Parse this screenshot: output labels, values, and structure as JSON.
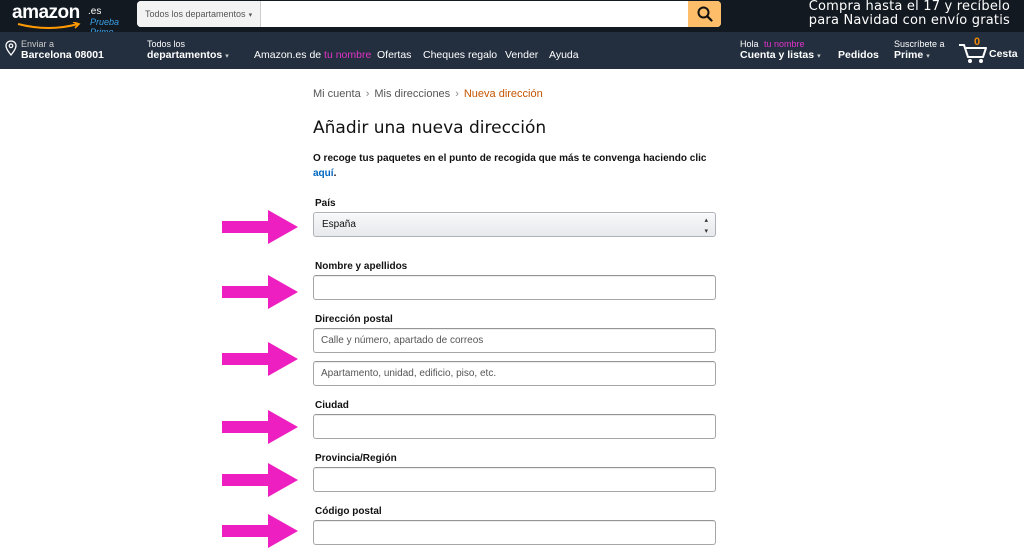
{
  "header": {
    "logo_word": "amazon",
    "logo_tld": ".es",
    "logo_prime": "Prueba Prime",
    "search_dept_label": "Todos los departamentos",
    "search_placeholder": "",
    "promo_line1": "Compra hasta el 17 y recíbelo",
    "promo_line2": "para Navidad con envío gratis"
  },
  "nav": {
    "deliver_line1": "Enviar a",
    "deliver_line2": "Barcelona 08001",
    "departments_line1": "Todos los",
    "departments_line2": "departamentos",
    "links": {
      "amazon_of_prefix": "Amazon.es de",
      "amazon_of_name": "tu nombre",
      "offers": "Ofertas",
      "gift_cards": "Cheques regalo",
      "sell": "Vender",
      "help": "Ayuda"
    },
    "account_hello": "Hola",
    "account_name": "tu nombre",
    "account_line2": "Cuenta y listas",
    "orders": "Pedidos",
    "prime_line1": "Suscríbete a",
    "prime_line2": "Prime",
    "cart_count": "0",
    "cart_label": "Cesta"
  },
  "breadcrumb": {
    "item1": "Mi cuenta",
    "item2": "Mis direcciones",
    "current": "Nueva dirección",
    "separator": "›"
  },
  "page": {
    "title": "Añadir una nueva dirección",
    "pickup_text": "O recoge tus paquetes en el punto de recogida que más te convenga haciendo clic",
    "pickup_link": "aquí",
    "pickup_period": "."
  },
  "form": {
    "country_label": "País",
    "country_value": "España",
    "name_label": "Nombre y apellidos",
    "name_value": "",
    "address_label": "Dirección postal",
    "address1_placeholder": "Calle y número, apartado de correos",
    "address2_placeholder": "Apartamento, unidad, edificio, piso, etc.",
    "city_label": "Ciudad",
    "city_value": "",
    "province_label": "Provincia/Región",
    "province_value": "",
    "postal_label": "Código postal",
    "postal_value": ""
  },
  "colors": {
    "nav_dark": "#131921",
    "nav_belt": "#232f3e",
    "search_button": "#febd69",
    "highlight_pink": "#e233c9",
    "annotation_arrow": "#ee1fc0",
    "link_blue": "#0066c0",
    "breadcrumb_current": "#c45500"
  },
  "icons": {
    "search": "search-icon",
    "location": "location-pin-icon",
    "cart": "cart-icon",
    "arrow": "pointer-arrow-icon"
  }
}
